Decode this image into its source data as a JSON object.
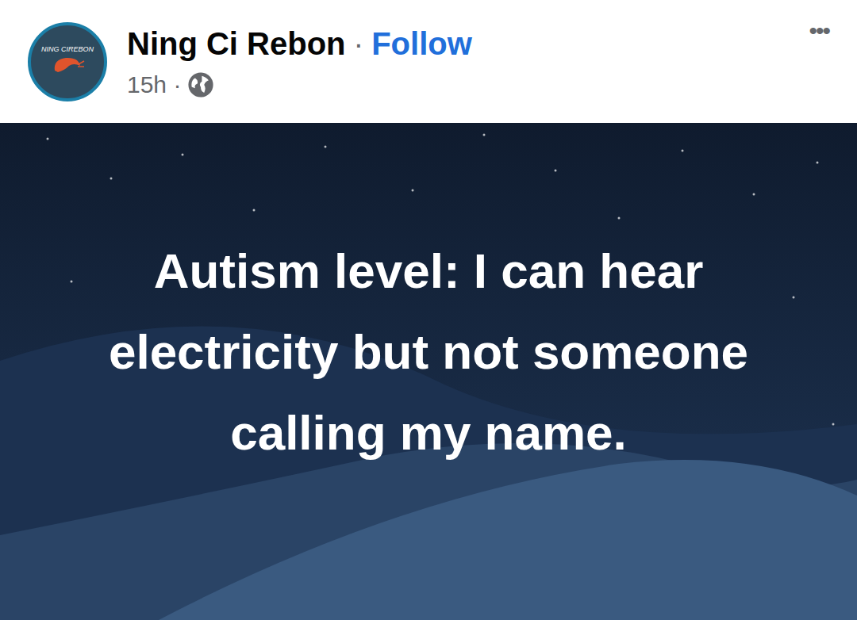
{
  "avatar": {
    "text": "NING CIREBON"
  },
  "header": {
    "name": "Ning Ci Rebon",
    "separator": "·",
    "follow": "Follow",
    "time": "15h ·",
    "more": "•••"
  },
  "post": {
    "text": "Autism level: I can hear electricity but not someone calling my name."
  }
}
